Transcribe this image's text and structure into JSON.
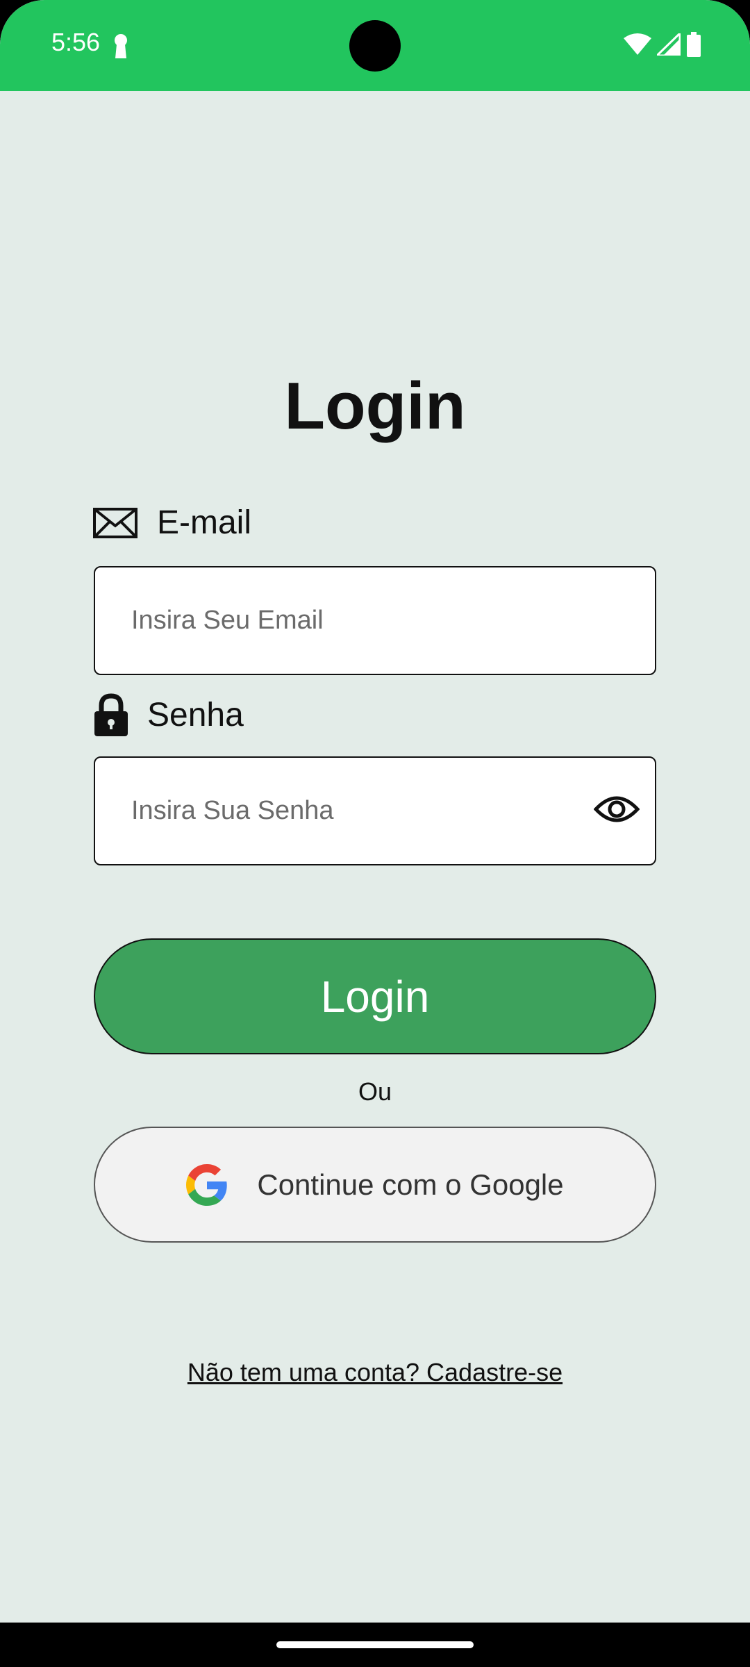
{
  "status_bar": {
    "time": "5:56",
    "icons": [
      "keyhole-icon",
      "wifi-icon",
      "signal-icon",
      "battery-icon"
    ],
    "color": "#22c55e"
  },
  "page": {
    "title": "Login",
    "background": "#e3ece8"
  },
  "email": {
    "label": "E-mail",
    "icon": "envelope-icon",
    "placeholder": "Insira Seu Email",
    "value": ""
  },
  "password": {
    "label": "Senha",
    "icon": "lock-icon",
    "placeholder": "Insira Sua Senha",
    "value": "",
    "toggle_icon": "eye-icon"
  },
  "login_button": {
    "label": "Login",
    "color": "#3da15c"
  },
  "divider_text": "Ou",
  "google_button": {
    "label": "Continue com o Google",
    "icon": "google-icon"
  },
  "signup_link": "Não tem uma conta? Cadastre-se"
}
